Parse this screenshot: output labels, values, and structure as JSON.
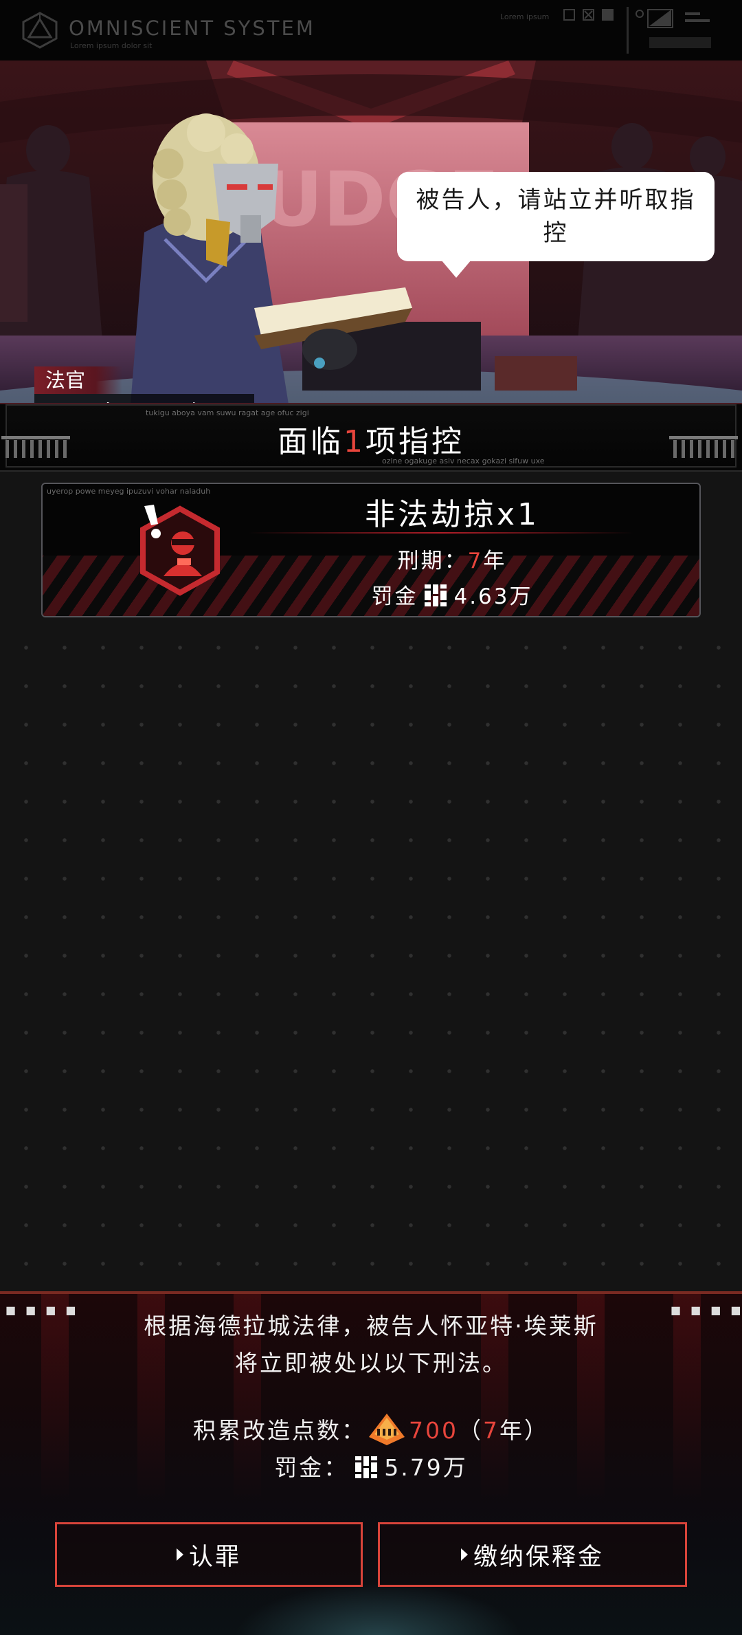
{
  "topbar": {
    "title": "OMNISCIENT SYSTEM",
    "subtitle": "Lorem ipsum dolor sit",
    "lorem_label": "Lorem ipsum"
  },
  "scene": {
    "speech": "被告人，请站立并听取指控",
    "judge_role": "法官",
    "judge_name": "公正真理III型",
    "wall_text": "JUDGE"
  },
  "charges_header": {
    "prefix": "面临",
    "count": "1",
    "suffix": "项指控",
    "tiny_top": "tukigu aboya vam suwu ragat age ofuc zigi",
    "tiny_bottom": "ozine ogakuge asiv necax gokazi sifuw uxe"
  },
  "charges": [
    {
      "tiny": "uyerop powe meyeg ipuzuvi vohar naladuh",
      "name": "非法劫掠x1",
      "sentence_label": "刑期：",
      "sentence_years": "7",
      "sentence_unit": "年",
      "fine_label": "罚金",
      "fine_value": "4.63万",
      "icon": "robber-hex-icon"
    }
  ],
  "verdict": {
    "line1": "根据海德拉城法律，被告人怀亚特·埃莱斯",
    "line2": "将立即被处以以下刑法。",
    "points_label": "积累改造点数：",
    "points_value": "700",
    "points_paren_open": "（",
    "points_years": "7",
    "points_paren_close": "年）",
    "fine_label": "罚金：",
    "fine_value": "5.79万"
  },
  "buttons": {
    "confess": "认罪",
    "bail": "缴纳保释金"
  },
  "colors": {
    "accent_red": "#e8453c",
    "button_border": "#d8443a",
    "points_orange": "#f07a2a"
  }
}
